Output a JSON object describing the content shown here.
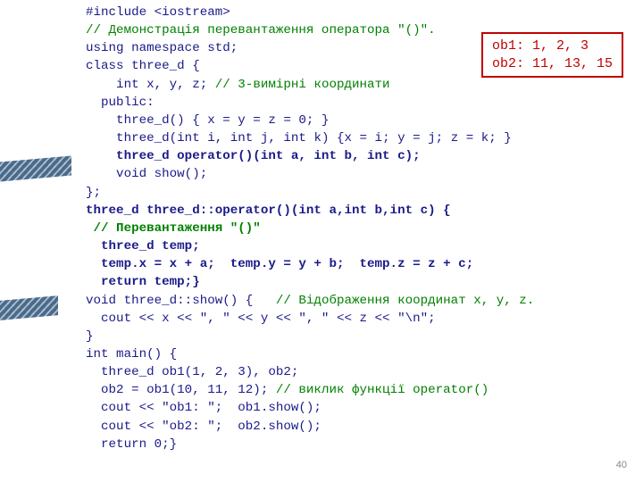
{
  "code": {
    "l1a": "#include ",
    "l1b": "<iostream>",
    "l2": "// Демонстрація перевантаження оператора \"()\".",
    "l3a": "using namespace",
    "l3b": " std;",
    "l4a": "class",
    "l4b": " three_d {",
    "l5a": "    int",
    "l5b": " x, y, z; ",
    "l5c": "// 3-вимірні координати",
    "l6": "  public:",
    "l7": "    three_d() { x = y = z = 0; }",
    "l8a": "    three_d(",
    "l8b": "int",
    "l8c": " i, ",
    "l8d": "int",
    "l8e": " j, ",
    "l8f": "int",
    "l8g": " k) {x = i; y = j; z = k; }",
    "l9": "    three_d operator()(int a, int b, int c);",
    "l10": "    void show();",
    "l11": "};",
    "l12": "three_d three_d::operator()(int a,int b,int c) {",
    "l13": " // Перевантаження \"()\"",
    "l14": "  three_d temp;",
    "l15": "  temp.x = x + a;  temp.y = y + b;  temp.z = z + c;",
    "l16": "  return temp;}",
    "l17a": "void",
    "l17b": " three_d::show() {   ",
    "l17c": "// Відображення координат x, y, z.",
    "l18": "  cout << x << \", \" << y << \", \" << z << \"\\n\";",
    "l19": "}",
    "l20a": "int",
    "l20b": " main() {",
    "l21": "  three_d ob1(1, 2, 3), ob2;",
    "l22a": "  ob2 = ob1(10, 11, 12); ",
    "l22b": "// виклик функції operator()",
    "l23": "  cout << \"ob1: \";  ob1.show();",
    "l24": "  cout << \"ob2: \";  ob2.show();",
    "l25a": "  return",
    "l25b": " 0;}"
  },
  "output": {
    "line1": "ob1: 1, 2, 3",
    "line2": "ob2: 11, 13, 15"
  },
  "page_number": "40"
}
